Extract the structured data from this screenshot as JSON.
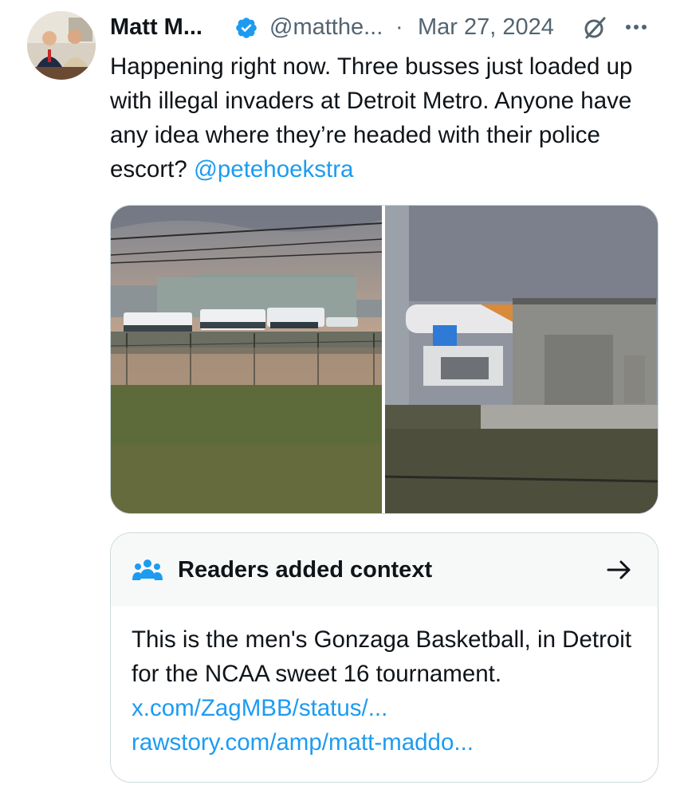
{
  "tweet": {
    "display_name": "Matt M...",
    "handle": "@matthe...",
    "separator": "·",
    "date": "Mar 27, 2024",
    "text_before_mention": "Happening right now. Three busses just loaded up with illegal invaders at Detroit Metro. Anyone have any idea where they’re headed with their police escort? ",
    "mention": "@petehoekstra"
  },
  "community_note": {
    "title": "Readers added context",
    "body": "This is the men's Gonzaga Basketball, in Detroit for the NCAA sweet 16 tournament.",
    "links": [
      "x.com/ZagMBB/status/...",
      "rawstory.com/amp/matt-maddo..."
    ]
  },
  "icons": {
    "verified": "verified-badge-icon",
    "grok": "grok-icon",
    "more": "more-options-icon",
    "people": "people-group-icon",
    "arrow": "arrow-right-icon"
  },
  "colors": {
    "accent": "#1d9bf0",
    "text": "#0f1419",
    "muted": "#536471",
    "note_header_bg": "#f7f9f9"
  }
}
